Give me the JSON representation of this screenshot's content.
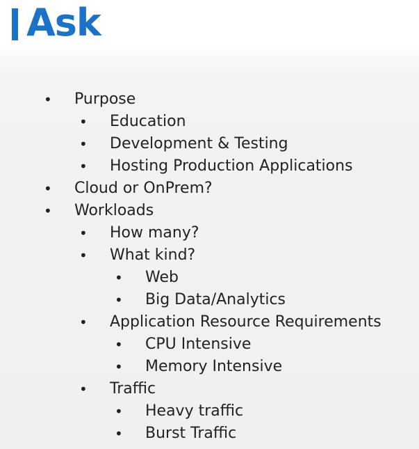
{
  "slide": {
    "title": "Ask",
    "bullet_char": "•",
    "accent_color": "#1a73c8",
    "items": [
      {
        "text": "Purpose"
      },
      {
        "text": "Education"
      },
      {
        "text": "Development & Testing"
      },
      {
        "text": "Hosting Production Applications"
      },
      {
        "text": "Cloud or OnPrem?"
      },
      {
        "text": "Workloads"
      },
      {
        "text": "How many?"
      },
      {
        "text": "What kind?"
      },
      {
        "text": "Web"
      },
      {
        "text": "Big Data/Analytics"
      },
      {
        "text": "Application Resource Requirements"
      },
      {
        "text": "CPU Intensive"
      },
      {
        "text": "Memory Intensive"
      },
      {
        "text": "Traffic"
      },
      {
        "text": "Heavy traffic"
      },
      {
        "text": "Burst Traffic"
      }
    ]
  }
}
